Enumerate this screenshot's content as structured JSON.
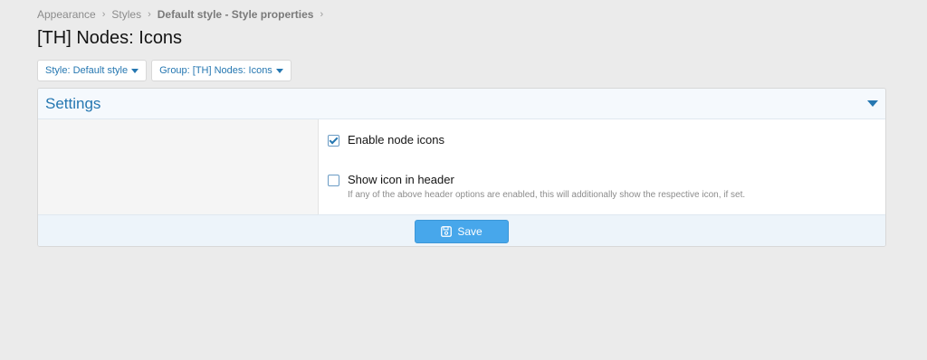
{
  "breadcrumb": {
    "items": [
      "Appearance",
      "Styles",
      "Default style - Style properties"
    ],
    "separator_icon": "chevron-right-icon"
  },
  "page": {
    "title": "[TH] Nodes: Icons"
  },
  "filters": {
    "style_label": "Style: Default style",
    "group_label": "Group: [TH] Nodes: Icons"
  },
  "settings": {
    "title": "Settings",
    "toggle_icon": "caret-down-icon",
    "options": [
      {
        "label": "Enable node icons",
        "checked": true,
        "hint": ""
      },
      {
        "label": "Show icon in header",
        "checked": false,
        "hint": "If any of the above header options are enabled, this will additionally show the respective icon, if set."
      }
    ]
  },
  "footer": {
    "save_label": "Save",
    "save_icon": "floppy-disk-icon"
  },
  "colors": {
    "accent": "#2577b1",
    "button": "#47a7eb",
    "background": "#ebebeb"
  }
}
